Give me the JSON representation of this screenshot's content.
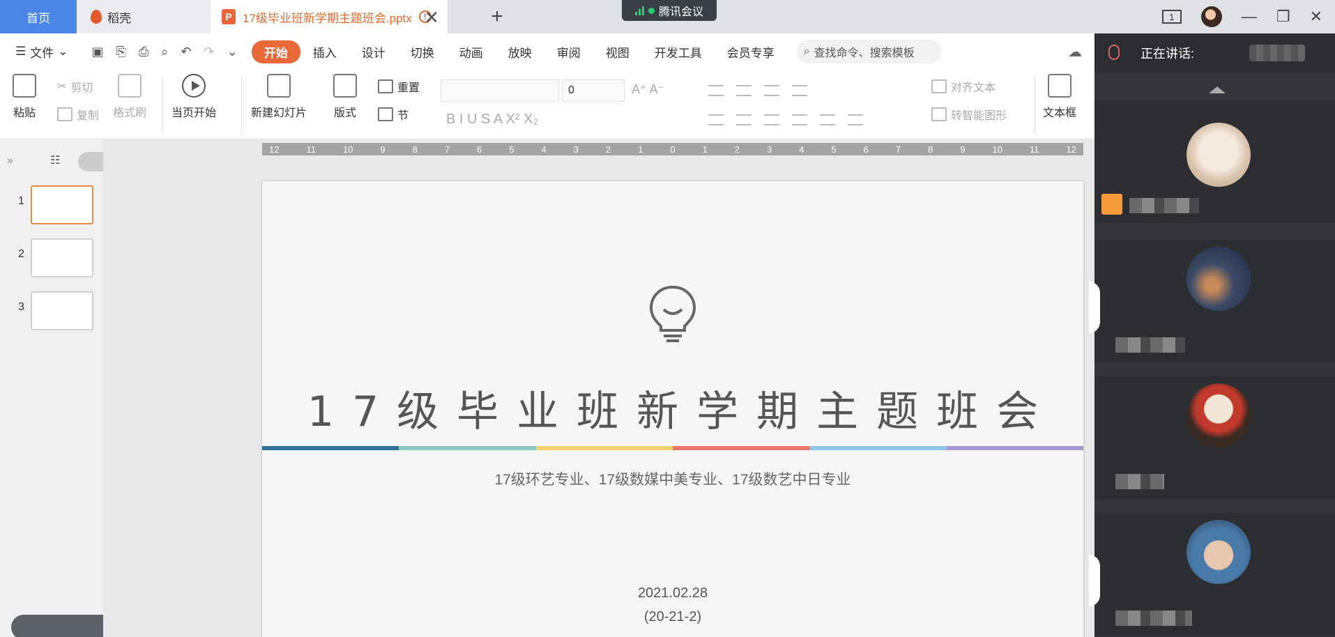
{
  "tabs": {
    "home": "首页",
    "docer": "稻壳",
    "document": "17级毕业班新学期主题班会.pptx",
    "document_badge": "P",
    "warning": "!",
    "close": "✕",
    "add": "+"
  },
  "meeting_badge": "腾讯会议",
  "window": {
    "indicator": "1",
    "minimize": "—",
    "restore": "❐",
    "close": "✕"
  },
  "menu": {
    "file": "文件",
    "items": [
      "开始",
      "插入",
      "设计",
      "切换",
      "动画",
      "放映",
      "审阅",
      "视图",
      "开发工具",
      "会员专享"
    ],
    "active": "开始",
    "search_placeholder": "查找命令、搜索模板"
  },
  "toolbar": {
    "paste": "粘贴",
    "cut": "剪切",
    "copy": "复制",
    "format_painter": "格式刷",
    "start_from_current": "当页开始",
    "new_slide": "新建幻灯片",
    "layout": "版式",
    "reset": "重置",
    "section": "节",
    "font_size": "0",
    "align_text": "对齐文本",
    "smart_shape": "转智能图形",
    "text_box": "文本框",
    "font_decor": "A⁺ A⁻",
    "format_glyphs": "B  I  U  S  A  X²  X₂"
  },
  "ruler_labels": [
    "12",
    "11",
    "10",
    "9",
    "8",
    "7",
    "6",
    "5",
    "4",
    "3",
    "2",
    "1",
    "0",
    "1",
    "2",
    "3",
    "4",
    "5",
    "6",
    "7",
    "8",
    "9",
    "10",
    "11",
    "12"
  ],
  "thumbnails": [
    {
      "num": "1",
      "selected": true
    },
    {
      "num": "2",
      "selected": false
    },
    {
      "num": "3",
      "selected": false
    }
  ],
  "slide": {
    "title": "17级毕业班新学期主题班会",
    "subtitle": "17级环艺专业、17级数媒中美专业、17级数艺中日专业",
    "date": "2021.02.28",
    "term": "(20-21-2)",
    "color_bar": [
      "#2f6f98",
      "#8dc9c3",
      "#f2d06b",
      "#e8766b",
      "#8ec6e6",
      "#a796cf"
    ]
  },
  "meeting": {
    "speaking_label": "正在讲话:"
  }
}
